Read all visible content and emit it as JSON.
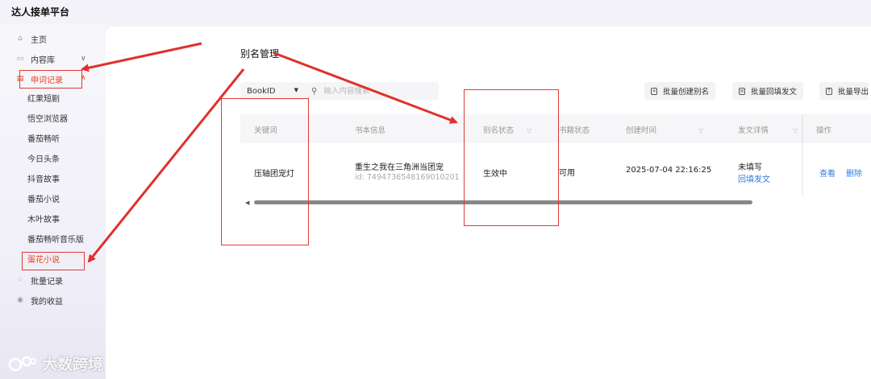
{
  "app": {
    "title": "达人接单平台"
  },
  "sidebar": {
    "items": [
      {
        "label": "主页",
        "icon": "home-icon"
      },
      {
        "label": "内容库",
        "icon": "inbox-icon"
      },
      {
        "label": "申词记录",
        "icon": "document-icon",
        "active": true
      },
      {
        "label": "批量记录",
        "icon": "grid-icon"
      },
      {
        "label": "我的收益",
        "icon": "coin-icon"
      }
    ],
    "subitems": [
      "红果短剧",
      "悟空浏览器",
      "番茄畅听",
      "今日头条",
      "抖音故事",
      "番茄小说",
      "木叶故事",
      "番茄畅听音乐版",
      "蛋花小说"
    ],
    "active_subitem": "蛋花小说"
  },
  "main": {
    "title": "别名管理",
    "filter": {
      "select_value": "BookID",
      "search_placeholder": "输入内容搜索"
    },
    "toolbar": {
      "create_alias": "批量创建别名",
      "fill_post": "批量回填发文",
      "export": "批量导出"
    },
    "table": {
      "headers": [
        "关键词",
        "书本信息",
        "别名状态",
        "书籍状态",
        "创建时间",
        "发文详情",
        "操作"
      ],
      "rows": [
        {
          "keyword": "压轴团宠灯",
          "book_title": "重生之我在三角洲当团宠",
          "book_id": "id: 7494736548169010201",
          "alias_status": "生效中",
          "book_status": "可用",
          "created_at": "2025-07-04 22:16:25",
          "post_status": "未填写",
          "post_action": "回填发文",
          "action_view": "查看",
          "action_delete": "删除"
        }
      ]
    }
  },
  "colors": {
    "accent": "#e8431e",
    "link": "#2f7de1",
    "annotation": "#e03a3a"
  },
  "watermark": {
    "text": "大数跨境"
  }
}
